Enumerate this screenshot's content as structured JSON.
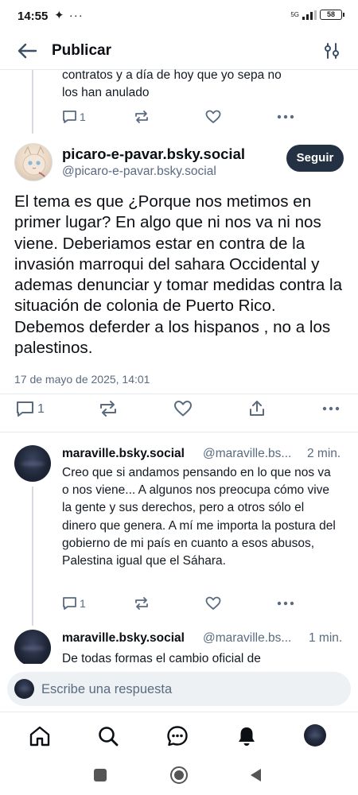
{
  "status": {
    "time": "14:55",
    "extra": "✦ ···",
    "network": "5G",
    "battery": "58"
  },
  "header": {
    "title": "Publicar"
  },
  "prev_post": {
    "lines": [
      "contratos y a día de hoy que yo sepa no",
      "los han anulado"
    ],
    "reply_count": "1"
  },
  "main_post": {
    "author_name": "picaro-e-pavar.bsky.social",
    "author_handle": "@picaro-e-pavar.bsky.social",
    "follow_label": "Seguir",
    "text": "El tema es que ¿Porque nos metimos en primer lugar? En algo que ni nos va ni nos viene. Deberiamos estar en contra de la invasión marroqui del sahara Occidental y ademas denunciar y tomar medidas contra la situación de colonia de Puerto Rico. Debemos deferder a los hispanos , no a los palestinos.",
    "date": "17 de mayo de 2025, 14:01",
    "reply_count": "1"
  },
  "replies": [
    {
      "author_name": "maraville.bsky.social",
      "author_handle": "@maraville.bs...",
      "time": "2 min.",
      "text": "Creo que si andamos pensando en lo que nos va o nos viene... A algunos nos preocupa cómo vive la gente y sus derechos, pero a otros sólo el dinero que genera. A mí me importa la postura del gobierno de mi país en cuanto a esos abusos, Palestina igual que el Sáhara.",
      "reply_count": "1"
    },
    {
      "author_name": "maraville.bsky.social",
      "author_handle": "@maraville.bs...",
      "time": "1 min.",
      "text": "De todas formas el cambio oficial de"
    }
  ],
  "composer": {
    "placeholder": "Escribe una respuesta"
  },
  "icons": {
    "back": "arrow-left-icon",
    "filter": "sliders-icon",
    "reply": "speech-bubble-icon",
    "repost": "repost-icon",
    "like": "heart-icon",
    "share": "share-icon",
    "more": "ellipsis-icon",
    "home": "home-icon",
    "search": "search-icon",
    "chat": "chat-icon",
    "notifications": "bell-icon"
  },
  "colors": {
    "accent_dark": "#233142",
    "muted": "#5a6b80",
    "thread_line": "#d6dbe2"
  }
}
